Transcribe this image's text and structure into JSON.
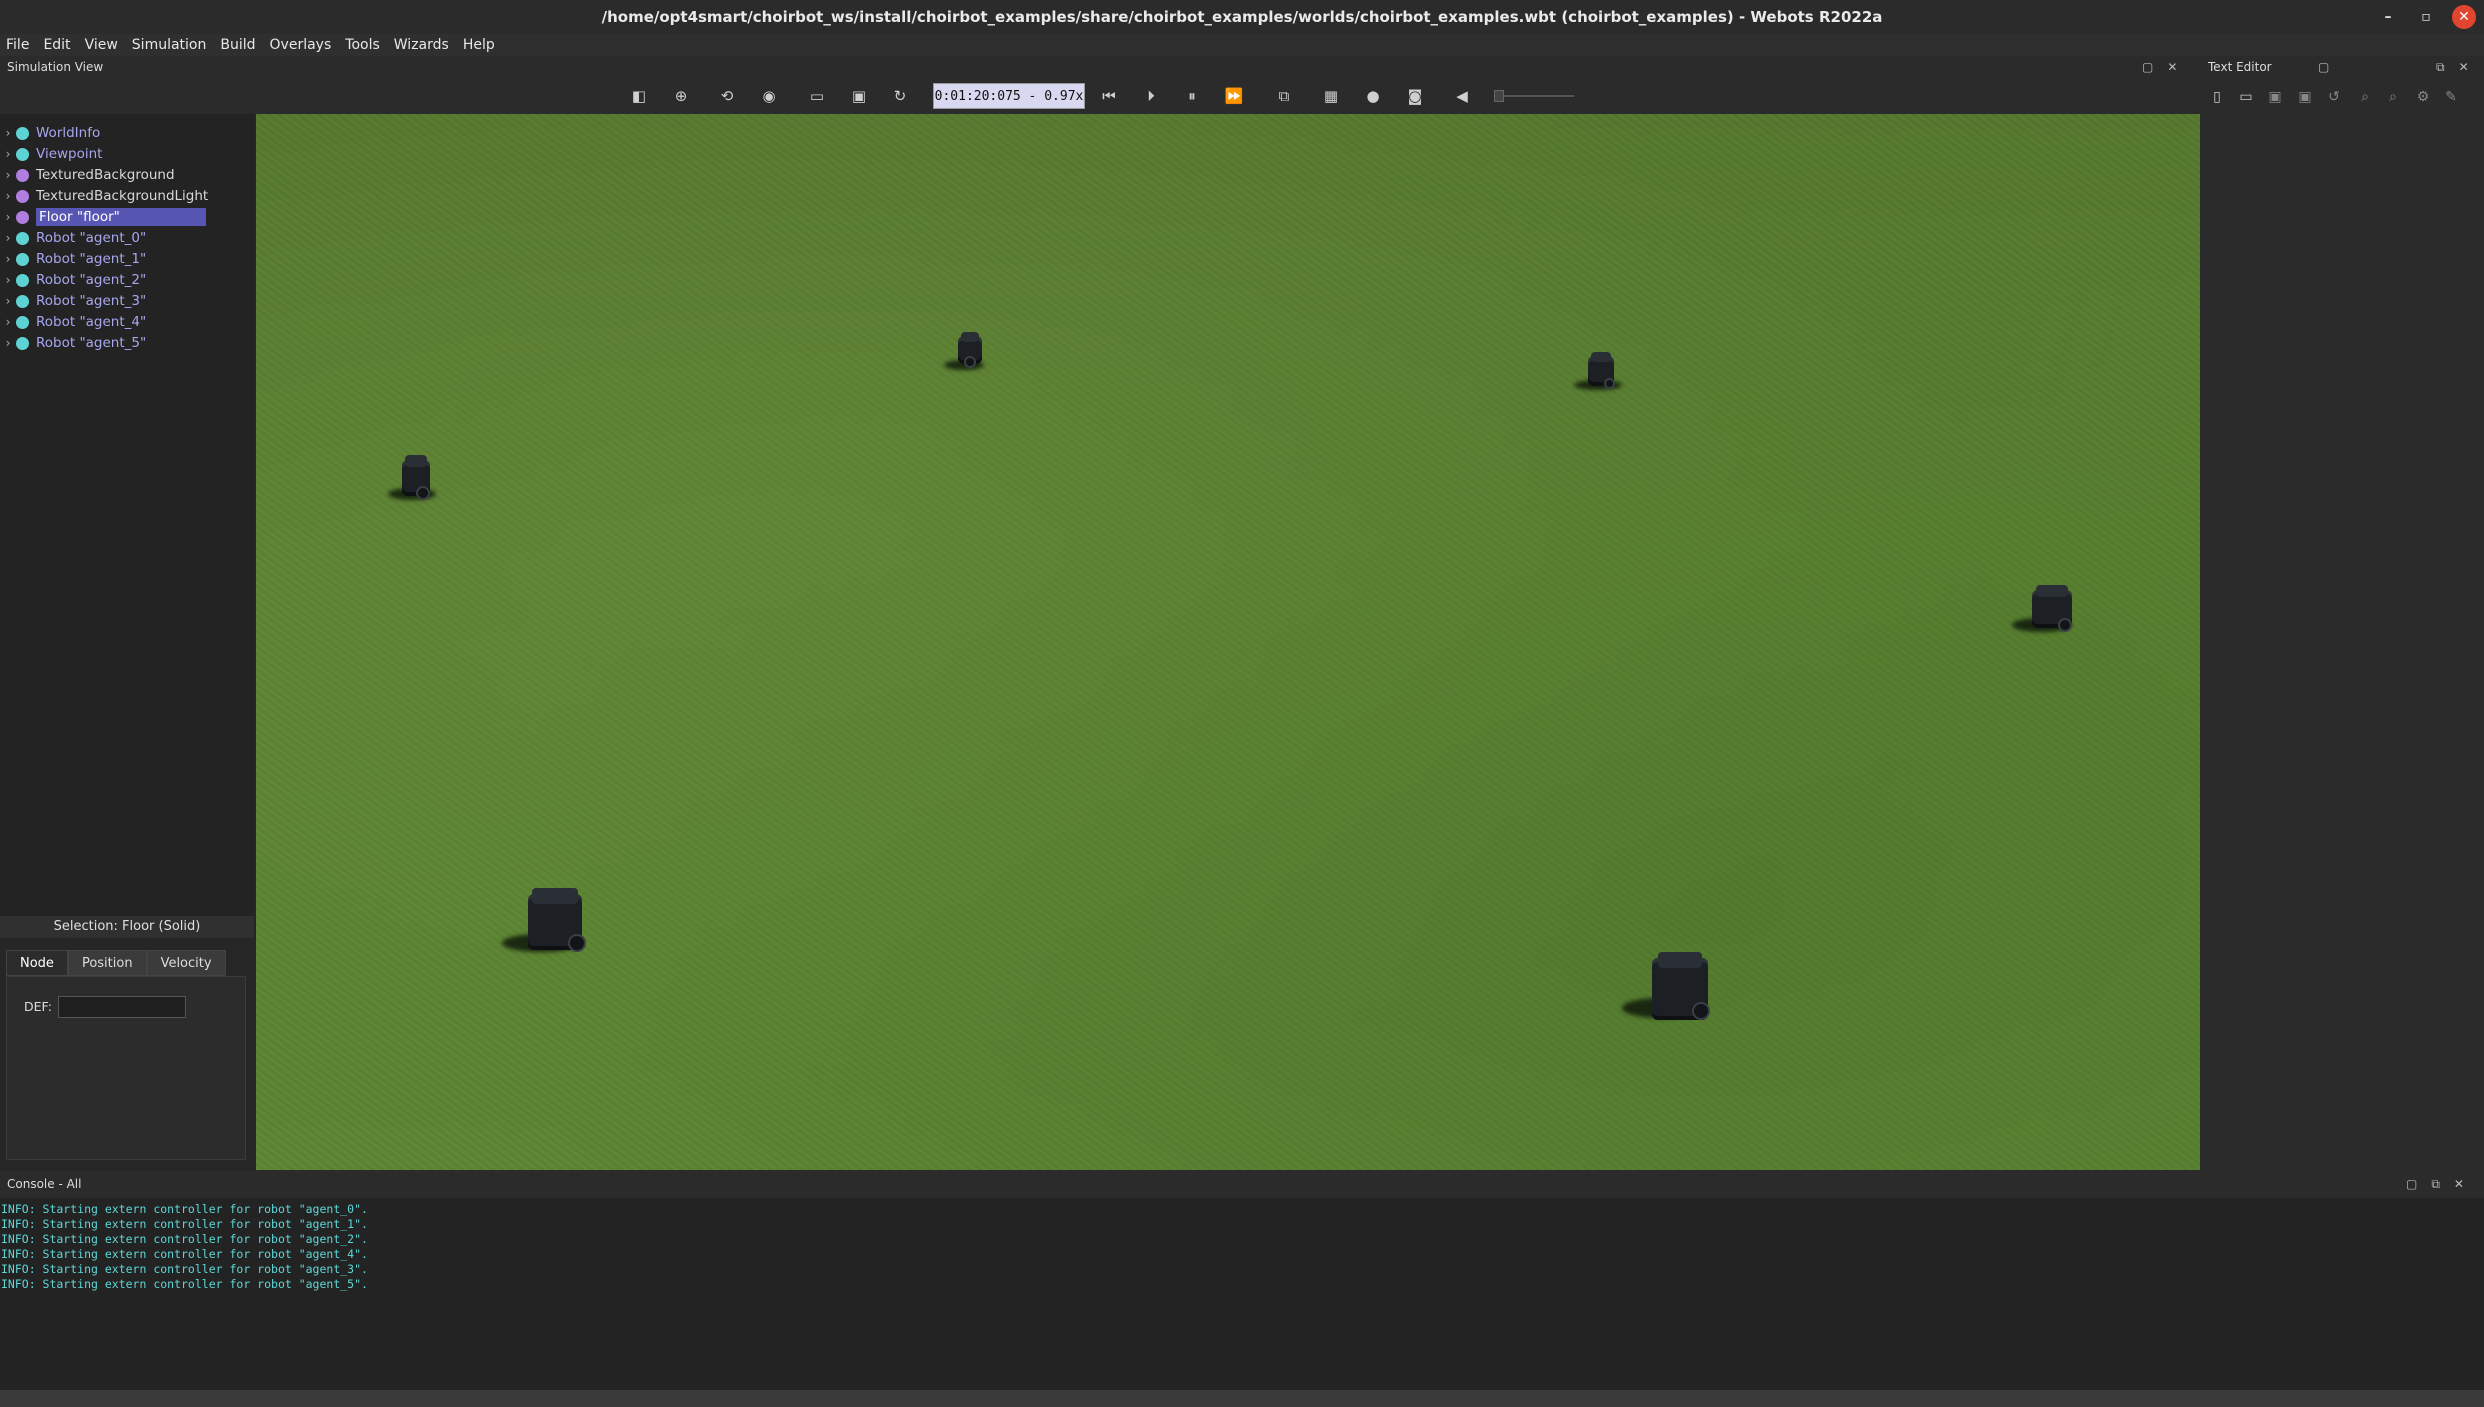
{
  "window": {
    "title": "/home/opt4smart/choirbot_ws/install/choirbot_examples/share/choirbot_examples/worlds/choirbot_examples.wbt (choirbot_examples) - Webots R2022a"
  },
  "menu": [
    {
      "label": "File"
    },
    {
      "label": "Edit"
    },
    {
      "label": "View"
    },
    {
      "label": "Simulation"
    },
    {
      "label": "Build"
    },
    {
      "label": "Overlays"
    },
    {
      "label": "Tools"
    },
    {
      "label": "Wizards"
    },
    {
      "label": "Help"
    }
  ],
  "simulation_view": {
    "title": "Simulation View",
    "time_display": "0:01:20:075  -  0.97x"
  },
  "scene_tree": {
    "items": [
      {
        "label": "WorldInfo",
        "color": "#5ed3d3",
        "style": "link"
      },
      {
        "label": "Viewpoint",
        "color": "#5ed3d3",
        "style": "link"
      },
      {
        "label": "TexturedBackground",
        "color": "#b07ee0",
        "style": "normal"
      },
      {
        "label": "TexturedBackgroundLight",
        "color": "#b07ee0",
        "style": "normal"
      },
      {
        "label": "Floor \"floor\"",
        "color": "#b07ee0",
        "style": "selected"
      },
      {
        "label": "Robot \"agent_0\"",
        "color": "#5ed3d3",
        "style": "link"
      },
      {
        "label": "Robot \"agent_1\"",
        "color": "#5ed3d3",
        "style": "link"
      },
      {
        "label": "Robot \"agent_2\"",
        "color": "#5ed3d3",
        "style": "link"
      },
      {
        "label": "Robot \"agent_3\"",
        "color": "#5ed3d3",
        "style": "link"
      },
      {
        "label": "Robot \"agent_4\"",
        "color": "#5ed3d3",
        "style": "link"
      },
      {
        "label": "Robot \"agent_5\"",
        "color": "#5ed3d3",
        "style": "link"
      }
    ]
  },
  "properties": {
    "selection": "Selection: Floor (Solid)",
    "tabs": [
      "Node",
      "Position",
      "Velocity"
    ],
    "active_tab": "Node",
    "def_label": "DEF:",
    "def_value": ""
  },
  "text_editor": {
    "title": "Text Editor"
  },
  "console": {
    "title": "Console - All",
    "lines": [
      "INFO: Starting extern controller for robot \"agent_0\".",
      "INFO: Starting extern controller for robot \"agent_1\".",
      "INFO: Starting extern controller for robot \"agent_2\".",
      "INFO: Starting extern controller for robot \"agent_4\".",
      "INFO: Starting extern controller for robot \"agent_3\".",
      "INFO: Starting extern controller for robot \"agent_5\"."
    ]
  }
}
